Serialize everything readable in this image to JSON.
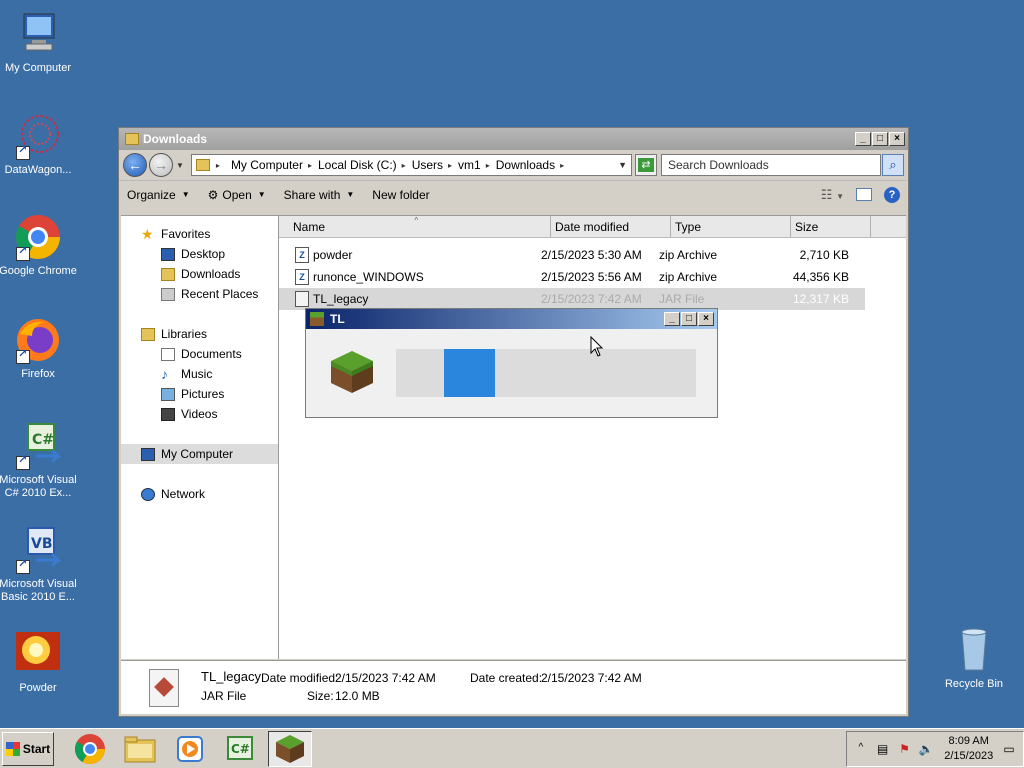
{
  "desktop": {
    "icons": [
      {
        "label": "My Computer"
      },
      {
        "label": "DataWagon..."
      },
      {
        "label": "Google Chrome"
      },
      {
        "label": "Firefox"
      },
      {
        "label": "Microsoft Visual C# 2010 Ex..."
      },
      {
        "label": "Microsoft Visual Basic 2010 E..."
      },
      {
        "label": "Powder"
      },
      {
        "label": "Recycle Bin"
      }
    ]
  },
  "explorer": {
    "title": "Downloads",
    "breadcrumb": [
      "My Computer",
      "Local Disk (C:)",
      "Users",
      "vm1",
      "Downloads"
    ],
    "search_placeholder": "Search Downloads",
    "toolbar": {
      "organize": "Organize",
      "open": "Open",
      "share_with": "Share with",
      "new_folder": "New folder"
    },
    "nav": {
      "favorites": "Favorites",
      "desktop": "Desktop",
      "downloads": "Downloads",
      "recent_places": "Recent Places",
      "libraries": "Libraries",
      "documents": "Documents",
      "music": "Music",
      "pictures": "Pictures",
      "videos": "Videos",
      "my_computer": "My Computer",
      "network": "Network"
    },
    "columns": {
      "name": "Name",
      "date_modified": "Date modified",
      "type": "Type",
      "size": "Size"
    },
    "files": [
      {
        "name": "powder",
        "date": "2/15/2023 5:30 AM",
        "type": "zip Archive",
        "size": "2,710 KB"
      },
      {
        "name": "runonce_WINDOWS",
        "date": "2/15/2023 5:56 AM",
        "type": "zip Archive",
        "size": "44,356 KB"
      },
      {
        "name": "TL_legacy",
        "date": "2/15/2023 7:42 AM",
        "type": "JAR File",
        "size": "12,317 KB"
      }
    ],
    "details": {
      "name": "TL_legacy",
      "type": "JAR File",
      "date_modified_label": "Date modified:",
      "date_modified": "2/15/2023 7:42 AM",
      "date_created_label": "Date created:",
      "date_created": "2/15/2023 7:42 AM",
      "size_label": "Size:",
      "size": "12.0 MB"
    }
  },
  "tl_window": {
    "title": "TL",
    "progress_chunk_start": 0.16,
    "progress_chunk_end": 0.33
  },
  "taskbar": {
    "start": "Start",
    "clock_time": "8:09 AM",
    "clock_date": "2/15/2023"
  },
  "colors": {
    "desktop": "#3a6ea5",
    "progress": "#2a86dd",
    "selection": "#d7d7d7"
  }
}
